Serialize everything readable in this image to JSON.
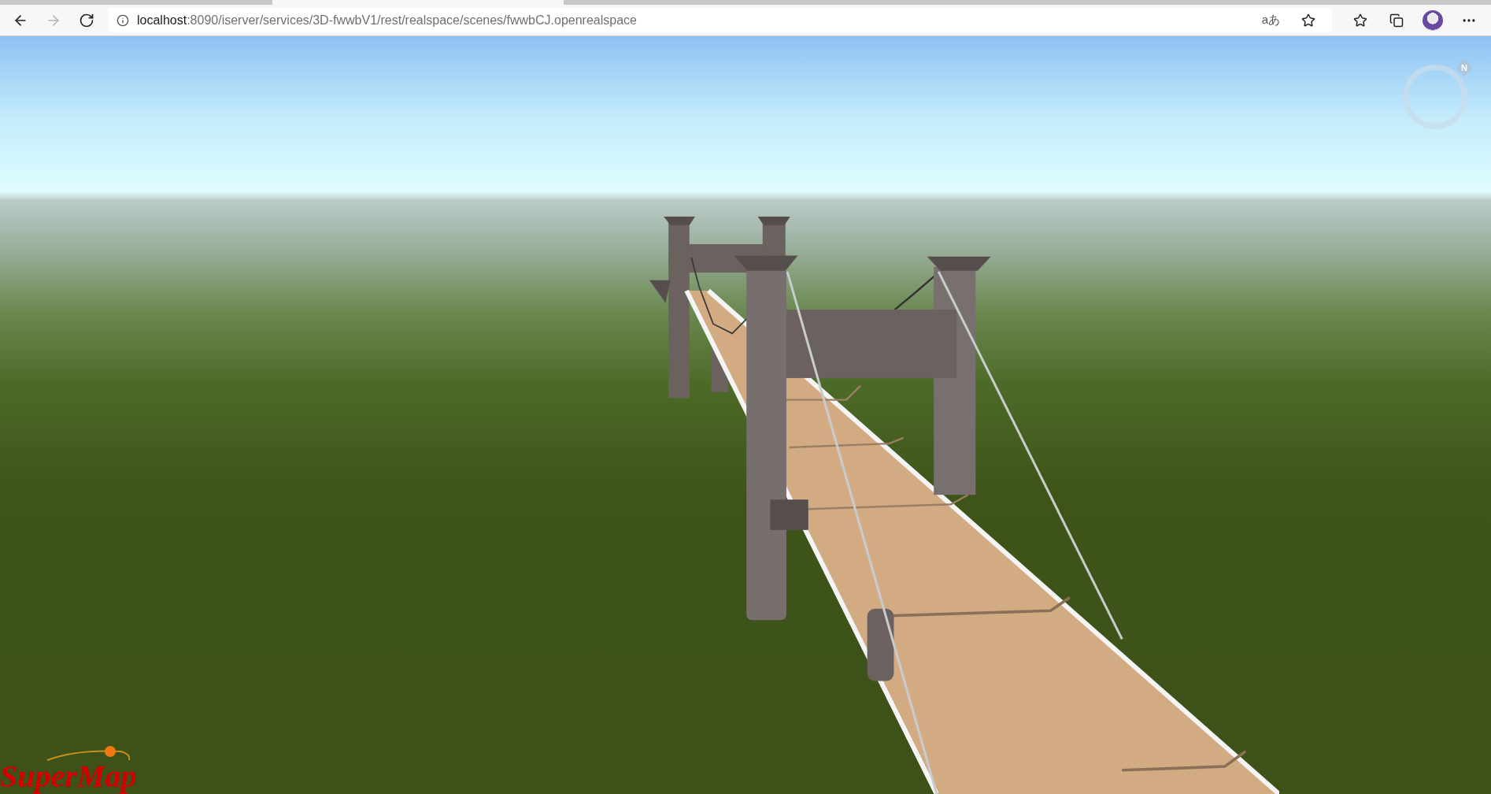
{
  "browser": {
    "nav_buttons": [
      {
        "kind": "back",
        "disabled": false
      },
      {
        "kind": "forward",
        "disabled": true
      },
      {
        "kind": "reload",
        "disabled": false
      }
    ],
    "address": {
      "host": "localhost",
      "path": ":8090/iserver/services/3D-fwwbV1/rest/realspace/scenes/fwwbCJ.openrealspace"
    },
    "read_aloud": "aあ",
    "toolbar": [
      {
        "kind": "favorites"
      },
      {
        "kind": "collections"
      },
      {
        "kind": "profile"
      },
      {
        "kind": "more"
      }
    ]
  },
  "scene": {
    "compass": {
      "label": "N"
    },
    "logo": {
      "text": "SuperMap"
    }
  }
}
